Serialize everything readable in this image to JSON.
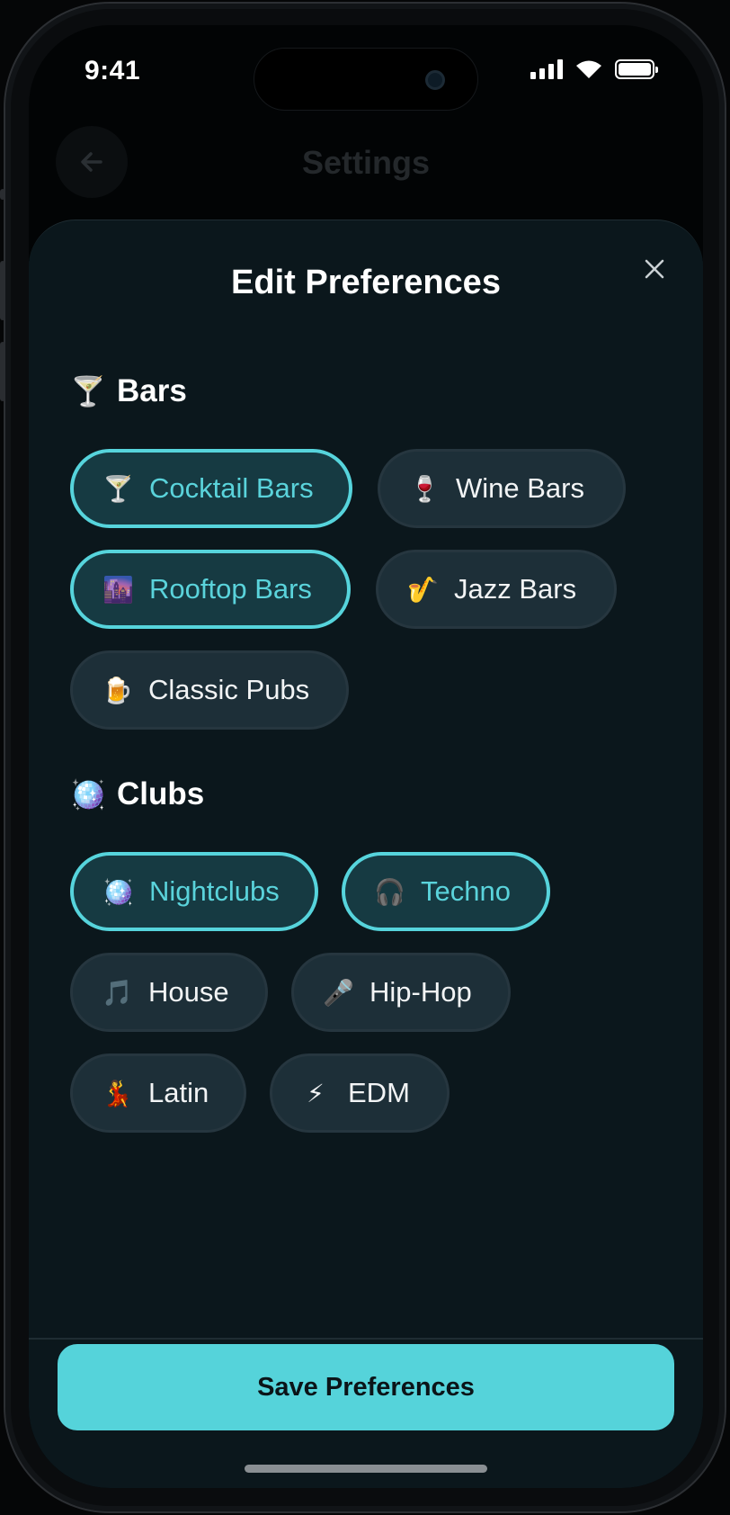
{
  "status_bar": {
    "time": "9:41"
  },
  "background_screen": {
    "title": "Settings"
  },
  "sheet": {
    "title": "Edit Preferences",
    "sections": [
      {
        "emoji": "🍸",
        "label": "Bars",
        "chips": [
          {
            "emoji": "🍸",
            "label": "Cocktail Bars",
            "selected": true
          },
          {
            "emoji": "🍷",
            "label": "Wine Bars",
            "selected": false
          },
          {
            "emoji": "🌆",
            "label": "Rooftop Bars",
            "selected": true
          },
          {
            "emoji": "🎷",
            "label": "Jazz Bars",
            "selected": false
          },
          {
            "emoji": "🍺",
            "label": "Classic Pubs",
            "selected": false
          }
        ]
      },
      {
        "emoji": "🪩",
        "label": "Clubs",
        "chips": [
          {
            "emoji": "🪩",
            "label": "Nightclubs",
            "selected": true
          },
          {
            "emoji": "🎧",
            "label": "Techno",
            "selected": true
          },
          {
            "emoji": "🎵",
            "label": "House",
            "selected": false
          },
          {
            "emoji": "🎤",
            "label": "Hip-Hop",
            "selected": false
          },
          {
            "emoji": "💃",
            "label": "Latin",
            "selected": false
          },
          {
            "emoji": "⚡",
            "label": "EDM",
            "selected": false
          }
        ]
      }
    ],
    "save_label": "Save Preferences"
  },
  "colors": {
    "accent": "#55d3da",
    "sheet_bg": "#0b171c",
    "chip_bg": "#1d2f38",
    "chip_selected_bg": "#163a42"
  }
}
